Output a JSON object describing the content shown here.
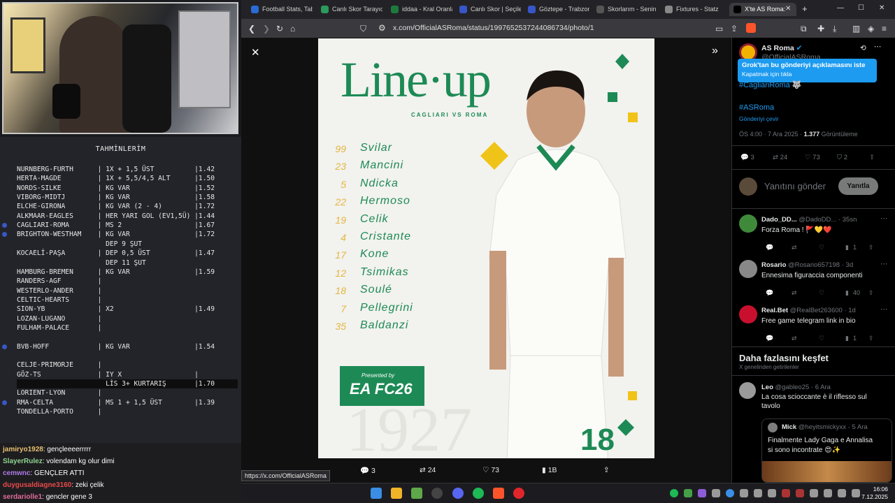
{
  "predictions": {
    "title": "TAHMİNLERİM",
    "rows": [
      {
        "text": "NURNBERG-FURTH      | 1X + 1,5 ÜST          |1.42",
        "dot": false
      },
      {
        "text": "HERTA-MAGDE         | 1X + 5,5/4,5 ALT      |1.50",
        "dot": false
      },
      {
        "text": "NORDS-SILKE         | KG VAR                |1.52",
        "dot": false
      },
      {
        "text": "VIBORG-MIDTJ        | KG VAR                |1.58",
        "dot": false
      },
      {
        "text": "ELCHE-GIRONA        | KG VAR (2 - 4)        |1.72",
        "dot": false
      },
      {
        "text": "ALKMAAR-EAGLES      | HER YARI GOL (EV1,5Ü) |1.44",
        "dot": false
      },
      {
        "text": "CAGLIARI-ROMA       | MS 2                  |1.67",
        "dot": true
      },
      {
        "text": "BRIGHTON-WESTHAM    | KG VAR                |1.72",
        "dot": true
      },
      {
        "text": "                      DEP 9 ŞUT",
        "dot": false
      },
      {
        "text": "KOCAELİ-PAŞA        | DEP 0,5 ÜST           |1.47",
        "dot": false
      },
      {
        "text": "                      DEP 11 ŞUT",
        "dot": false
      },
      {
        "text": "HAMBURG-BREMEN      | KG VAR                |1.59",
        "dot": false
      },
      {
        "text": "RANDERS-AGF         |",
        "dot": false
      },
      {
        "text": "WESTERLO-ANDER      |",
        "dot": false
      },
      {
        "text": "CELTIC-HEARTS       |",
        "dot": false
      },
      {
        "text": "SION-YB             | X2                    |1.49",
        "dot": false
      },
      {
        "text": "LOZAN-LUGANO        |",
        "dot": false
      },
      {
        "text": "FULHAM-PALACE       |",
        "dot": false
      },
      {
        "text": "",
        "dot": false
      },
      {
        "text": "BVB-HOFF            | KG VAR                |1.54",
        "dot": true
      },
      {
        "text": "",
        "dot": false
      },
      {
        "text": "CELJE-PRIMORJE      |",
        "dot": false
      },
      {
        "text": "GÖZ-TS              | IY X                  |",
        "dot": false
      },
      {
        "text": "                      LİS 3+ KURTARIŞ       |1.70",
        "dot": false,
        "hl": true
      },
      {
        "text": "LORIENT-LYON        |",
        "dot": false
      },
      {
        "text": "RMA-CELTA           | MS 1 + 1,5 ÜST        |1.39",
        "dot": true
      },
      {
        "text": "TONDELLA-PORTO      |",
        "dot": false
      }
    ]
  },
  "chat": [
    {
      "user": "jamiryo1928",
      "msg": ": gençleeeerrrrr",
      "color": "#e8c070"
    },
    {
      "user": "SlayerRulez",
      "msg": ": volendam kg olur dimi",
      "color": "#8fd48f"
    },
    {
      "user": "cemwnc",
      "msg": ": GENÇLER ATTI",
      "color": "#b07ae8"
    },
    {
      "user": "duygusaldiagne3160",
      "msg": ": zeki çelik",
      "color": "#e84a4a"
    },
    {
      "user": "serdariolle1",
      "msg": ": gencler gene 3",
      "color": "#e06c9a"
    }
  ],
  "tabs": [
    {
      "label": "Football Stats, Tabl",
      "color": "#2a6bd6"
    },
    {
      "label": "Canlı Skor Tarayıcı",
      "color": "#2b9a5a"
    },
    {
      "label": "iddaa - Kral Oranla",
      "color": "#1e7a3c"
    },
    {
      "label": "Canlı Skor | Seçile",
      "color": "#3856c9"
    },
    {
      "label": "Göztepe - Trabzon",
      "color": "#3856c9"
    },
    {
      "label": "Skorlarım - Senin i",
      "color": "#555555"
    },
    {
      "label": "Fixtures - Statz",
      "color": "#888888"
    },
    {
      "label": "X'te AS Roma:",
      "color": "#000000"
    }
  ],
  "toolbar": {
    "url": "x.com/OfficialASRoma/status/1997652537244086734/photo/1"
  },
  "poster": {
    "title": "Line·up",
    "match": "CAGLIARI VS ROMA",
    "players": [
      {
        "num": "99",
        "name": "Svilar"
      },
      {
        "num": "23",
        "name": "Mancini"
      },
      {
        "num": "5",
        "name": "Ndicka"
      },
      {
        "num": "22",
        "name": "Hermoso"
      },
      {
        "num": "19",
        "name": "Celik"
      },
      {
        "num": "4",
        "name": "Cristante"
      },
      {
        "num": "17",
        "name": "Kone"
      },
      {
        "num": "12",
        "name": "Tsimikas"
      },
      {
        "num": "18",
        "name": "Soulé"
      },
      {
        "num": "7",
        "name": "Pellegrini"
      },
      {
        "num": "35",
        "name": "Baldanzi"
      }
    ],
    "sponsor_presented": "Presented by",
    "sponsor_logo": "EA FC26",
    "shirt_number": "18"
  },
  "bottom_stats": {
    "replies": "3",
    "reposts": "24",
    "likes": "73",
    "views": "1B"
  },
  "tweet": {
    "name": "AS Roma",
    "handle": "@OfficialASRoma",
    "tooltip_title": "Grok'tan bu gönderiyi açıklamasını iste",
    "tooltip_sub": "Kapatmak için tıkla",
    "hashtag1": "#CagliariRoma 🐺",
    "hashtag2": "#ASRoma",
    "translate": "Gönderiyi çevir",
    "time": "ÖS 4:00 · 7 Ara 2025 ·",
    "views": "1.377",
    "views_label": "Görüntüleme",
    "replies": "3",
    "reposts": "24",
    "likes": "73",
    "bookmarks": "2",
    "reply_placeholder": "Yanıtını gönder",
    "reply_button": "Yanıtla"
  },
  "replies": [
    {
      "name": "Dado_DD...",
      "handle": "@DadoDD...",
      "time": "· 35sn",
      "text": "Forza Roma ! 🚩💛❤️",
      "views": "1",
      "avatar": "#3f8a3a"
    },
    {
      "name": "Rosario",
      "handle": "@Rosario657198",
      "time": "· 3d",
      "text": "Ennesima figuraccia componenti",
      "views": "40",
      "avatar": "#888888"
    },
    {
      "name": "Real.Bet",
      "handle": "@RealBet263600",
      "time": "· 1d",
      "text": "Free game telegram link in bio",
      "views": "1",
      "avatar": "#c8102e"
    }
  ],
  "discover": {
    "title": "Daha fazlasını keşfet",
    "sub": "X genelinden getirilenler",
    "post": {
      "name": "Leo",
      "handle": "@gableo25",
      "time": "· 6 Ara",
      "text1": "La cosa scioccante è il riflesso sul",
      "text2": "tavolo"
    },
    "quote": {
      "name": "Mick",
      "handle": "@heyitsmickyxx",
      "time": "· 5 Ara",
      "text1": "Finalmente Lady Gaga e Annalisa",
      "text2": "si sono incontrate 😍✨"
    }
  },
  "status_url": "https://x.com/OfficialASRoma",
  "clock": {
    "time": "16:06",
    "date": "7.12.2025"
  }
}
